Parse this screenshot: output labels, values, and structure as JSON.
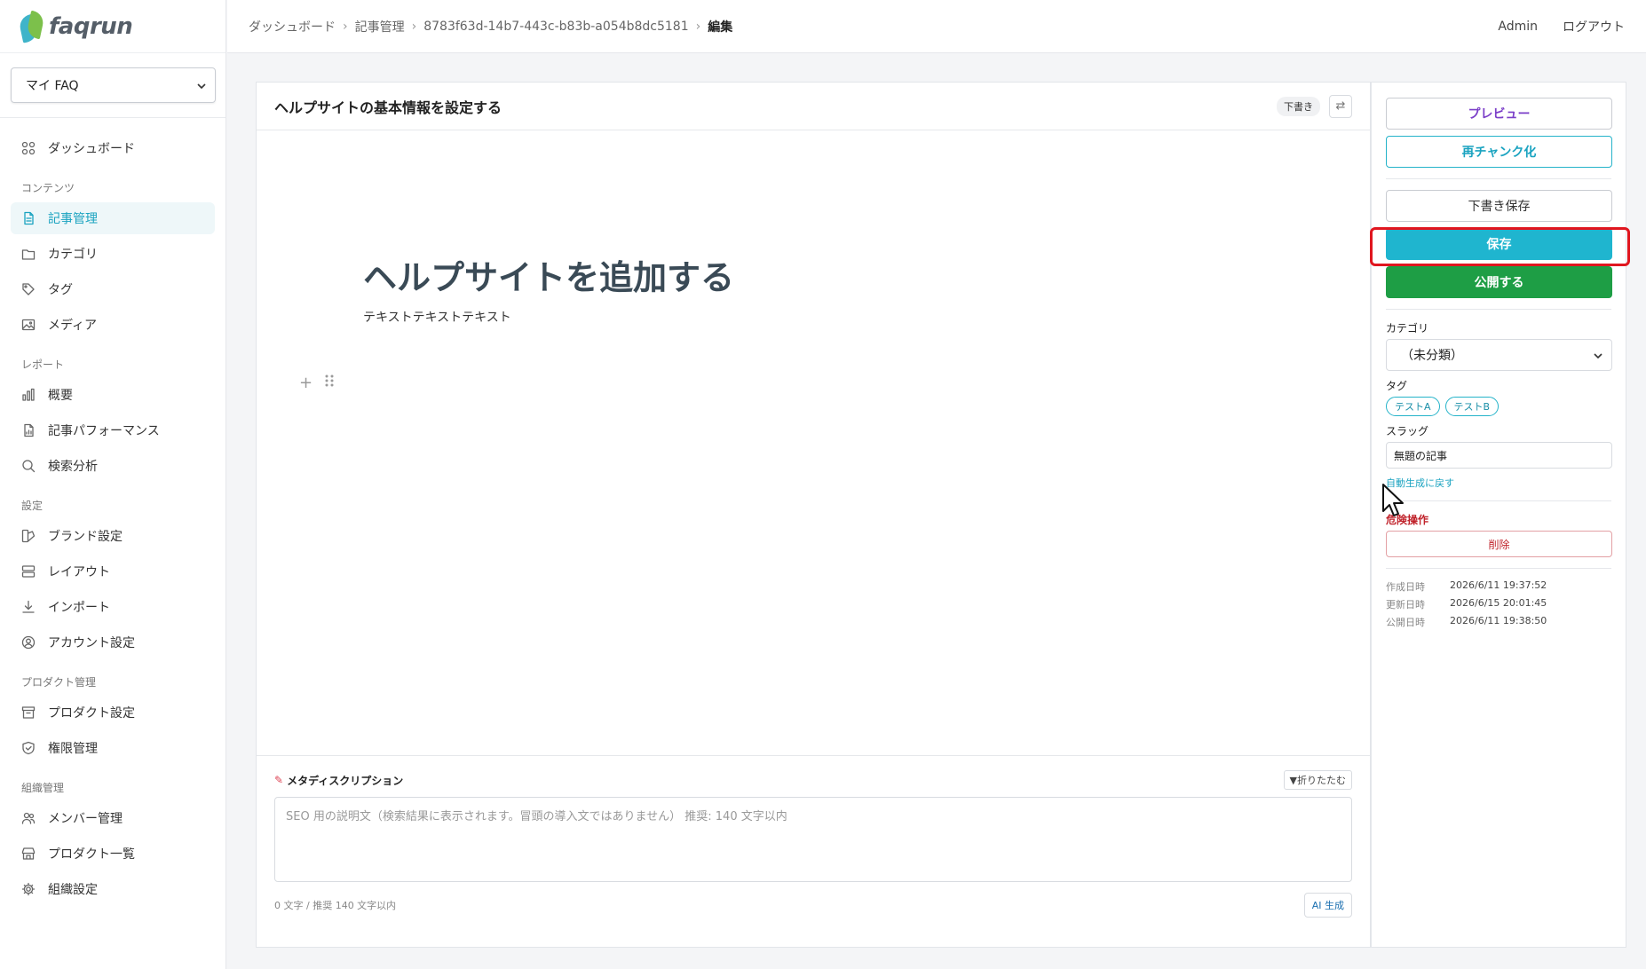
{
  "app": {
    "logo_text": "faqrun"
  },
  "sidebar": {
    "faq_select": "マイ FAQ",
    "top_item": {
      "label": "ダッシュボード",
      "icon": "grid-icon"
    },
    "sections": [
      {
        "title": "コンテンツ",
        "items": [
          {
            "label": "記事管理",
            "icon": "document-icon",
            "active": true
          },
          {
            "label": "カテゴリ",
            "icon": "folder-icon"
          },
          {
            "label": "タグ",
            "icon": "tag-icon"
          },
          {
            "label": "メディア",
            "icon": "image-icon"
          }
        ]
      },
      {
        "title": "レポート",
        "items": [
          {
            "label": "概要",
            "icon": "bar-chart-icon"
          },
          {
            "label": "記事パフォーマンス",
            "icon": "file-chart-icon"
          },
          {
            "label": "検索分析",
            "icon": "search-icon"
          }
        ]
      },
      {
        "title": "設定",
        "items": [
          {
            "label": "ブランド設定",
            "icon": "palette-icon"
          },
          {
            "label": "レイアウト",
            "icon": "layout-icon"
          },
          {
            "label": "インポート",
            "icon": "download-icon"
          },
          {
            "label": "アカウント設定",
            "icon": "user-circle-icon"
          }
        ]
      },
      {
        "title": "プロダクト管理",
        "items": [
          {
            "label": "プロダクト設定",
            "icon": "archive-icon"
          },
          {
            "label": "権限管理",
            "icon": "shield-icon"
          }
        ]
      },
      {
        "title": "組織管理",
        "items": [
          {
            "label": "メンバー管理",
            "icon": "users-icon"
          },
          {
            "label": "プロダクト一覧",
            "icon": "store-icon"
          },
          {
            "label": "組織設定",
            "icon": "gear-icon"
          }
        ]
      }
    ]
  },
  "header": {
    "breadcrumbs": [
      "ダッシュボード",
      "記事管理",
      "8783f63d-14b7-443c-b83b-a054b8dc5181"
    ],
    "current": "編集",
    "user": "Admin",
    "logout": "ログアウト"
  },
  "editor": {
    "title": "ヘルプサイトの基本情報を設定する",
    "status_badge": "下書き",
    "swap_icon": "⇄",
    "heading": "ヘルプサイトを追加する",
    "paragraph": "テキストテキストテキスト"
  },
  "meta": {
    "title": "メタディスクリプション",
    "fold_label": "▼折りたたむ",
    "placeholder": "SEO 用の説明文（検索結果に表示されます。冒頭の導入文ではありません） 推奨: 140 文字以内",
    "char_count": "0 文字 / 推奨 140 文字以内",
    "ai_button": "AI 生成"
  },
  "panel": {
    "preview": "プレビュー",
    "rechunk": "再チャンク化",
    "save_draft": "下書き保存",
    "save": "保存",
    "publish": "公開する",
    "category_label": "カテゴリ",
    "category_value": "（未分類）",
    "tags_label": "タグ",
    "tags": [
      "テストA",
      "テストB"
    ],
    "slug_label": "スラッグ",
    "slug_value": "無題の記事",
    "auto_generate_link": "自動生成に戻す",
    "danger_label": "危険操作",
    "delete": "削除",
    "dates": [
      {
        "label": "作成日時",
        "value": "2026/6/11 19:37:52"
      },
      {
        "label": "更新日時",
        "value": "2026/6/15 20:01:45"
      },
      {
        "label": "公開日時",
        "value": "2026/6/11 19:38:50"
      }
    ]
  },
  "colors": {
    "accent": "#1fb5cf",
    "publish": "#1e9e45",
    "highlight": "#e0161f",
    "danger": "#c0232b",
    "preview": "#7b3fc8"
  }
}
